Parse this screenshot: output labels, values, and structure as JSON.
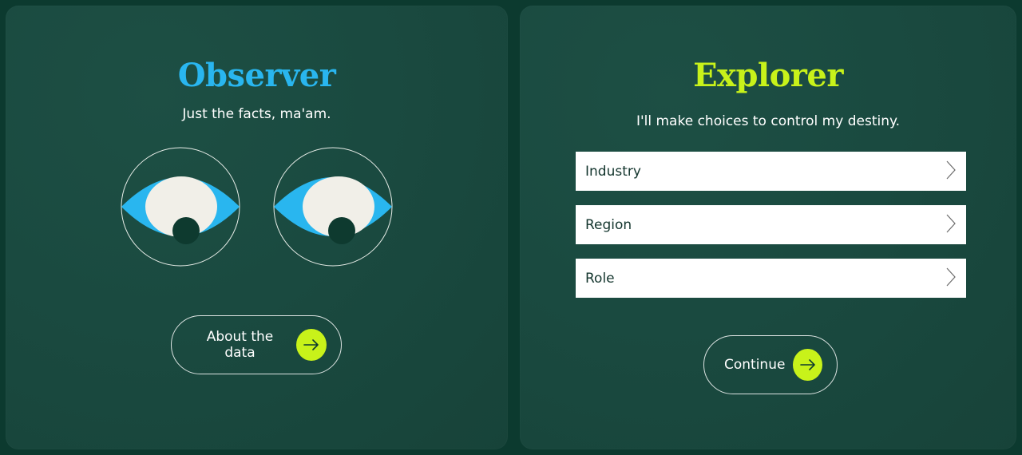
{
  "colors": {
    "observer_title": "#29b6ef",
    "explorer_title": "#c8f21a",
    "accent_button": "#c8f21a",
    "eye_iris": "#29b6ef",
    "eye_white": "#f1efe8",
    "pupil": "#0e3a2f"
  },
  "observer": {
    "title": "Observer",
    "subtitle": "Just the facts, ma'am.",
    "eyes_icon": "watching-eyes-icon",
    "button_label": "About the data",
    "button_icon": "arrow-right-icon"
  },
  "explorer": {
    "title": "Explorer",
    "subtitle": "I'll make choices to control my destiny.",
    "selects": [
      {
        "label": "Industry",
        "icon": "chevron-right-icon"
      },
      {
        "label": "Region",
        "icon": "chevron-right-icon"
      },
      {
        "label": "Role",
        "icon": "chevron-right-icon"
      }
    ],
    "button_label": "Continue",
    "button_icon": "arrow-right-icon"
  }
}
